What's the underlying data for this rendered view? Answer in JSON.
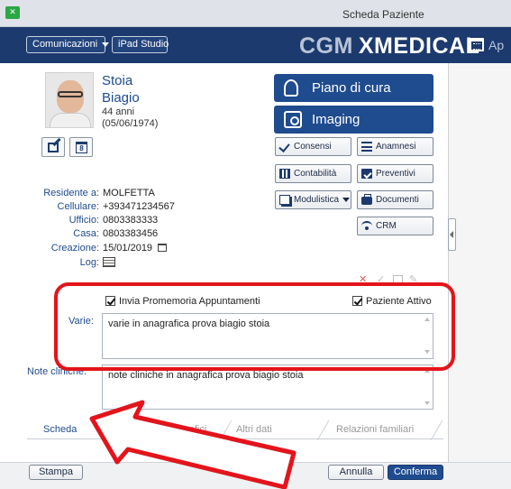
{
  "window": {
    "title": "Scheda Paziente"
  },
  "header": {
    "comunicazioni_label": "Comunicazioni",
    "ipad_label": "iPad Studio",
    "brand_prefix": "CGM",
    "brand_name": "XMEDICAL",
    "appointments_partial": "Ap"
  },
  "patient": {
    "surname": "Stoia",
    "first_name": "Biagio",
    "age": "44 anni",
    "birth_date": "(05/06/1974)"
  },
  "actions": {
    "piano_label": "Piano di cura",
    "imaging_label": "Imaging",
    "consensi_label": "Consensi",
    "anamnesi_label": "Anamnesi",
    "contabilita_label": "Contabilità",
    "preventivi_label": "Preventivi",
    "modulistica_label": "Modulistica",
    "documenti_label": "Documenti",
    "crm_label": "CRM"
  },
  "info": {
    "residente_label": "Residente a:",
    "residente_value": "MOLFETTA",
    "cellulare_label": "Cellulare:",
    "cellulare_value": "+393471234567",
    "ufficio_label": "Ufficio:",
    "ufficio_value": "0803383333",
    "casa_label": "Casa:",
    "casa_value": "0803383456",
    "creazione_label": "Creazione:",
    "creazione_value": "15/01/2019",
    "log_label": "Log:"
  },
  "form": {
    "promemoria_label": "Invia Promemoria Appuntamenti",
    "promemoria_checked": true,
    "attivo_label": "Paziente Attivo",
    "attivo_checked": true,
    "varie_label": "Varie:",
    "varie_value": "varie in anagrafica prova biagio stoia",
    "note_label": "Note cliniche:",
    "note_value": "note cliniche in anagrafica prova biagio stoia"
  },
  "tabs": [
    {
      "label": "Scheda",
      "active": true
    },
    {
      "label": "Dati anagrafici",
      "active": false
    },
    {
      "label": "Altri dati",
      "active": false
    },
    {
      "label": "Relazioni familiari",
      "active": false
    }
  ],
  "footer": {
    "stampa_label": "Stampa",
    "annulla_label": "Annulla",
    "conferma_label": "Conferma"
  },
  "colors": {
    "header_bg": "#1c3a6e",
    "primary_button": "#1f4b8f",
    "annotation_red": "#e3141b"
  }
}
